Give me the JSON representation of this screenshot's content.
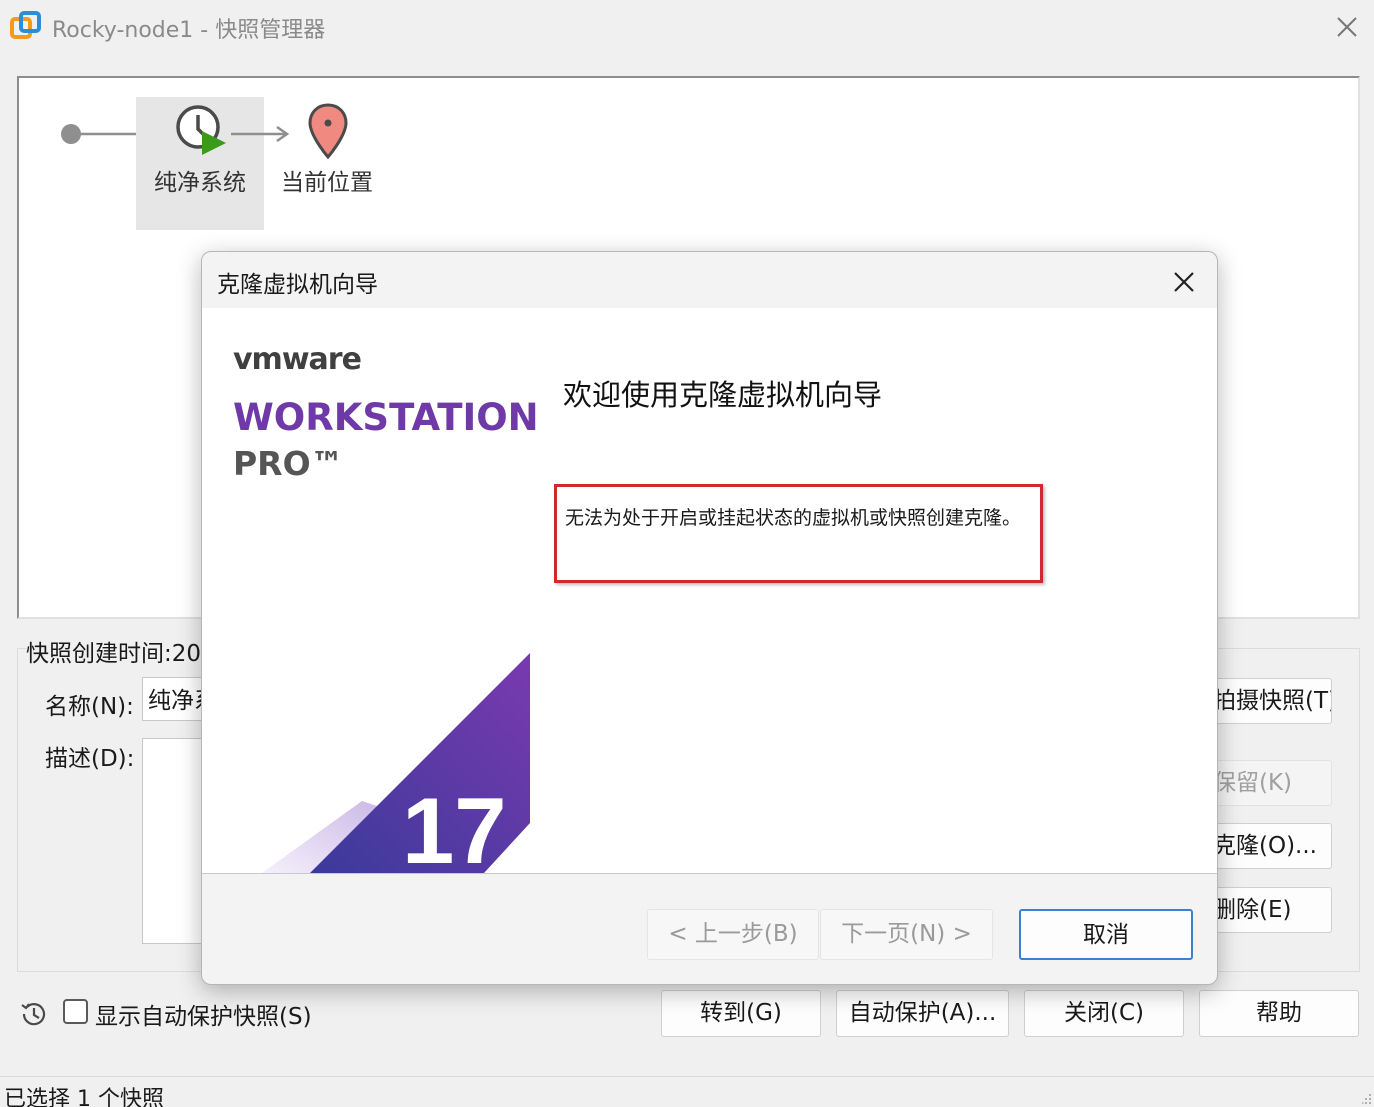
{
  "window": {
    "title": "Rocky-node1 - 快照管理器",
    "icon": "vmware-app-icon",
    "close_icon": "close-icon"
  },
  "snapshot_tree": {
    "snapshot_label": "纯净系统",
    "current_label": "当前位置"
  },
  "details": {
    "created_label": "快照创建时间:20",
    "name_label": "名称(N):",
    "name_value": "纯净系",
    "desc_label": "描述(D):",
    "desc_value": ""
  },
  "side_buttons": {
    "take_snapshot": "拍摄快照(T)...",
    "keep": "保留(K)",
    "clone": "克隆(O)...",
    "delete": "删除(E)"
  },
  "bottom": {
    "show_auto_label": "显示自动保护快照(S)",
    "show_auto_checked": false,
    "goto": "转到(G)",
    "autoprotect": "自动保护(A)...",
    "close": "关闭(C)",
    "help": "帮助"
  },
  "status": {
    "text": "已选择 1 个快照"
  },
  "dialog": {
    "title": "克隆虚拟机向导",
    "brand_vm": "vmware",
    "brand_product": "WORKSTATION",
    "brand_edition": "PRO™",
    "version": "17",
    "welcome": "欢迎使用克隆虚拟机向导",
    "message": "无法为处于开启或挂起状态的虚拟机或快照创建克隆。",
    "back_button": "< 上一步(B)",
    "next_button": "下一页(N) >",
    "cancel_button": "取消"
  },
  "colors": {
    "accent_purple": "#6f3aa8",
    "error_red": "#d0282c",
    "primary_border": "#3f7fcf"
  }
}
